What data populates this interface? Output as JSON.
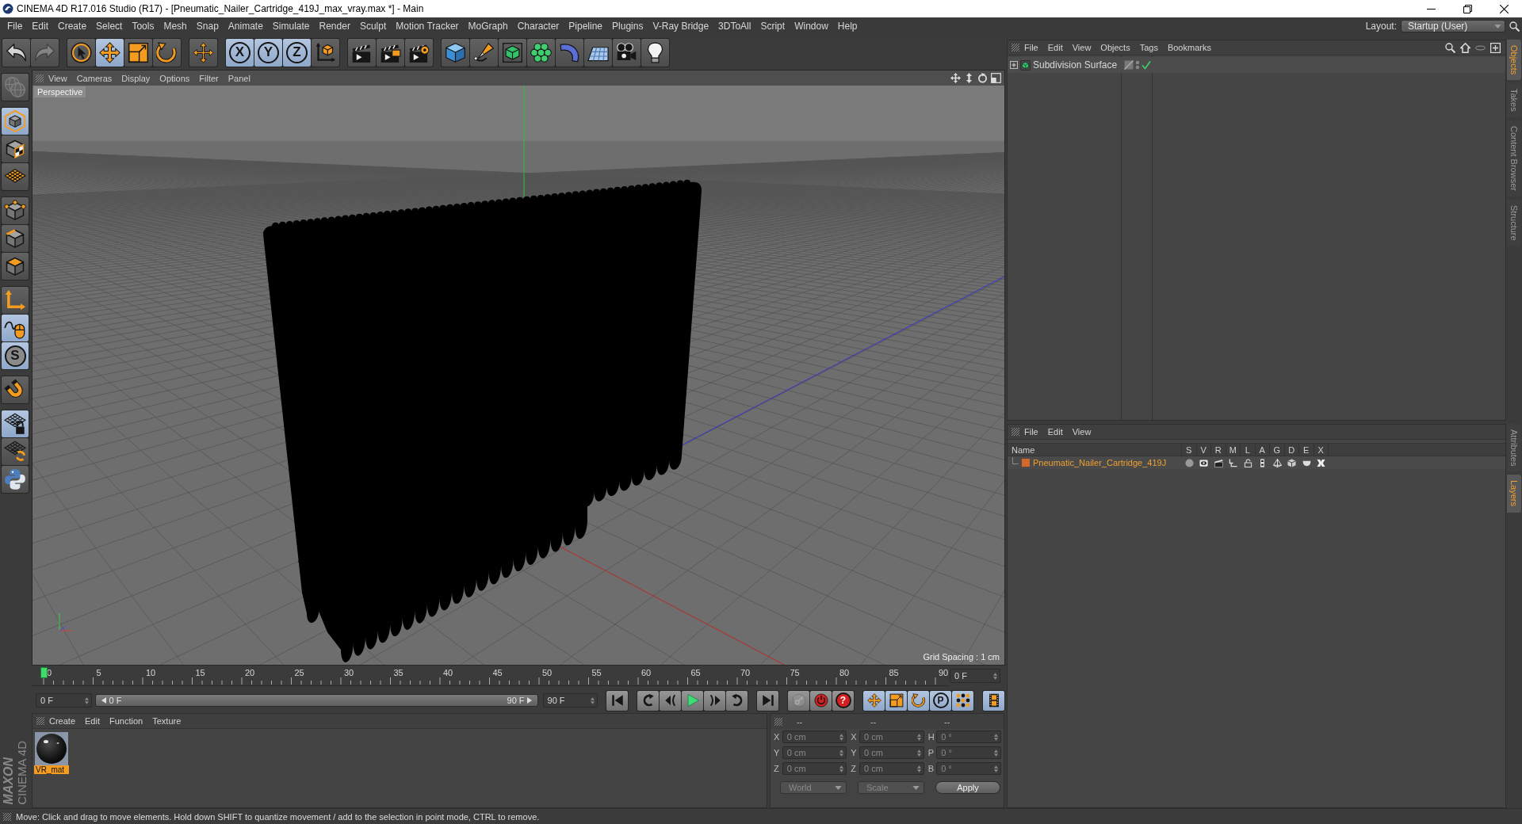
{
  "window": {
    "title": "CINEMA 4D R17.016 Studio (R17) - [Pneumatic_Nailer_Cartridge_419J_max_vray.max *] - Main"
  },
  "menu": [
    "File",
    "Edit",
    "Create",
    "Select",
    "Tools",
    "Mesh",
    "Snap",
    "Animate",
    "Simulate",
    "Render",
    "Sculpt",
    "Motion Tracker",
    "MoGraph",
    "Character",
    "Pipeline",
    "Plugins",
    "V-Ray Bridge",
    "3DToAll",
    "Script",
    "Window",
    "Help"
  ],
  "layout": {
    "label": "Layout:",
    "value": "Startup (User)"
  },
  "toolbar": {
    "groups": [
      {
        "items": [
          {
            "kind": "undo",
            "selected": false,
            "disabled": false
          },
          {
            "kind": "redo",
            "selected": false,
            "disabled": true
          }
        ]
      },
      {
        "items": [
          {
            "kind": "select",
            "selected": false,
            "disabled": false
          },
          {
            "kind": "move",
            "selected": true,
            "disabled": false
          },
          {
            "kind": "scale",
            "selected": false,
            "disabled": false
          },
          {
            "kind": "rotate",
            "selected": false,
            "disabled": false
          }
        ]
      },
      {
        "items": [
          {
            "kind": "transform",
            "selected": false,
            "disabled": false
          }
        ]
      },
      {
        "items": [
          {
            "kind": "axislock",
            "label": "X",
            "selected": true,
            "disabled": false
          },
          {
            "kind": "axislock",
            "label": "Y",
            "selected": true,
            "disabled": false
          },
          {
            "kind": "axislock",
            "label": "Z",
            "selected": true,
            "disabled": false
          },
          {
            "kind": "coords",
            "selected": false,
            "disabled": false
          }
        ]
      },
      {
        "items": [
          {
            "kind": "renderview",
            "selected": false,
            "disabled": false
          },
          {
            "kind": "renderpicture",
            "selected": false,
            "disabled": false
          },
          {
            "kind": "rendersettings",
            "selected": false,
            "disabled": false
          }
        ]
      },
      {
        "items": [
          {
            "kind": "cube",
            "selected": false,
            "disabled": false
          },
          {
            "kind": "pen",
            "selected": false,
            "disabled": false
          },
          {
            "kind": "subdivision",
            "selected": false,
            "disabled": false
          },
          {
            "kind": "cloner",
            "selected": false,
            "disabled": false
          },
          {
            "kind": "bend",
            "selected": false,
            "disabled": false
          },
          {
            "kind": "floor",
            "selected": false,
            "disabled": false
          },
          {
            "kind": "camera",
            "selected": false,
            "disabled": false
          },
          {
            "kind": "light",
            "selected": false,
            "disabled": false
          }
        ]
      }
    ]
  },
  "tools": {
    "groups": [
      {
        "items": [
          {
            "kind": "globe",
            "selected": false,
            "disabled": true
          }
        ]
      },
      {
        "items": [
          {
            "kind": "model",
            "selected": true,
            "disabled": false
          },
          {
            "kind": "texture",
            "selected": false,
            "disabled": false
          },
          {
            "kind": "workplane",
            "selected": false,
            "disabled": false
          }
        ]
      },
      {
        "items": [
          {
            "kind": "points",
            "selected": false,
            "disabled": false
          },
          {
            "kind": "edges",
            "selected": false,
            "disabled": false
          },
          {
            "kind": "polygons",
            "selected": false,
            "disabled": false
          }
        ]
      },
      {
        "items": [
          {
            "kind": "axis",
            "selected": false,
            "disabled": false
          },
          {
            "kind": "tweak",
            "selected": true,
            "disabled": false
          },
          {
            "kind": "solo",
            "label": "S",
            "selected": true,
            "disabled": false
          }
        ]
      },
      {
        "items": [
          {
            "kind": "magnet",
            "selected": false,
            "disabled": false
          }
        ]
      },
      {
        "items": [
          {
            "kind": "gridlock",
            "selected": true,
            "disabled": false
          },
          {
            "kind": "gridrotate",
            "selected": false,
            "disabled": false
          },
          {
            "kind": "python",
            "selected": false,
            "disabled": false
          }
        ]
      }
    ]
  },
  "viewport": {
    "menu": [
      "View",
      "Cameras",
      "Display",
      "Options",
      "Filter",
      "Panel"
    ],
    "camera": "Perspective",
    "grid_spacing": "Grid Spacing : 1 cm"
  },
  "timeline": {
    "labels": [
      "0",
      "5",
      "10",
      "15",
      "20",
      "25",
      "30",
      "35",
      "40",
      "45",
      "50",
      "55",
      "60",
      "65",
      "70",
      "75",
      "80",
      "85",
      "90"
    ],
    "playhead": {
      "level": 0
    },
    "current": "0 F"
  },
  "transport": {
    "start": "0 F",
    "range": {
      "start": "0 F",
      "end": "90 F"
    },
    "end": "90 F",
    "groups": [
      {
        "items": [
          {
            "kind": "first",
            "selected": false,
            "disabled": false
          }
        ]
      },
      {
        "items": [
          {
            "kind": "prevkey",
            "selected": false,
            "disabled": false
          },
          {
            "kind": "prevframe",
            "selected": false,
            "disabled": false
          },
          {
            "kind": "play",
            "selected": false,
            "disabled": false
          },
          {
            "kind": "nextframe",
            "selected": false,
            "disabled": false
          },
          {
            "kind": "nextkey",
            "selected": false,
            "disabled": false
          }
        ]
      },
      {
        "items": [
          {
            "kind": "last",
            "selected": false,
            "disabled": false
          }
        ]
      },
      {
        "items": [
          {
            "kind": "key",
            "selected": false,
            "disabled": true
          },
          {
            "kind": "record",
            "selected": false,
            "disabled": false
          },
          {
            "kind": "autokey",
            "label": "?",
            "selected": false,
            "disabled": false
          }
        ]
      },
      {
        "items": [
          {
            "kind": "keymove",
            "selected": true,
            "disabled": false
          },
          {
            "kind": "keyscale",
            "selected": true,
            "disabled": false
          },
          {
            "kind": "keyrotate",
            "selected": true,
            "disabled": false
          },
          {
            "kind": "paramkey",
            "label": "P",
            "selected": true,
            "disabled": false
          },
          {
            "kind": "keypoints",
            "selected": true,
            "disabled": false
          }
        ]
      },
      {
        "items": [
          {
            "kind": "film",
            "selected": true,
            "disabled": false
          }
        ]
      }
    ]
  },
  "logo": {
    "brand": "MAXON",
    "product": "CINEMA 4D"
  },
  "materials": {
    "menu": [
      "Create",
      "Edit",
      "Function",
      "Texture"
    ],
    "items": [
      {
        "name": "VR_mat",
        "selected": true
      }
    ]
  },
  "coordinates": {
    "headers": [
      "--",
      "--",
      "--"
    ],
    "disabled": true,
    "rows": [
      {
        "position_axis": "X",
        "position": "0 cm",
        "size_axis": "X",
        "size": "0 cm",
        "rotation_axis": "H",
        "rotation": "0 °"
      },
      {
        "position_axis": "Y",
        "position": "0 cm",
        "size_axis": "Y",
        "size": "0 cm",
        "rotation_axis": "P",
        "rotation": "0 °"
      },
      {
        "position_axis": "Z",
        "position": "0 cm",
        "size_axis": "Z",
        "size": "0 cm",
        "rotation_axis": "B",
        "rotation": "0 °"
      }
    ],
    "position_mode": "World",
    "size_mode": "Scale",
    "apply": "Apply"
  },
  "objects_panel": {
    "menu": [
      "File",
      "Edit",
      "View",
      "Objects",
      "Tags",
      "Bookmarks"
    ],
    "objects": [
      {
        "name": "Subdivision Surface",
        "expanded": false,
        "enabled": true
      }
    ]
  },
  "layers_panel": {
    "menu": [
      "File",
      "Edit",
      "View"
    ],
    "columns": [
      "Name",
      "S",
      "V",
      "R",
      "M",
      "L",
      "A",
      "G",
      "D",
      "E",
      "X"
    ],
    "layers": [
      {
        "name": "Pneumatic_Nailer_Cartridge_419J",
        "color": "#d2692a"
      }
    ]
  },
  "side_tabs": {
    "upper": [
      {
        "label": "Objects",
        "selected": true
      },
      {
        "label": "Takes",
        "selected": false
      },
      {
        "label": "Content Browser",
        "selected": false
      },
      {
        "label": "Structure",
        "selected": false
      }
    ],
    "lower": [
      {
        "label": "Attributes",
        "selected": false
      },
      {
        "label": "Layers",
        "selected": true
      }
    ]
  },
  "status_bar": "Move: Click and drag to move elements. Hold down SHIFT to quantize movement / add to the selection in point mode, CTRL to remove."
}
